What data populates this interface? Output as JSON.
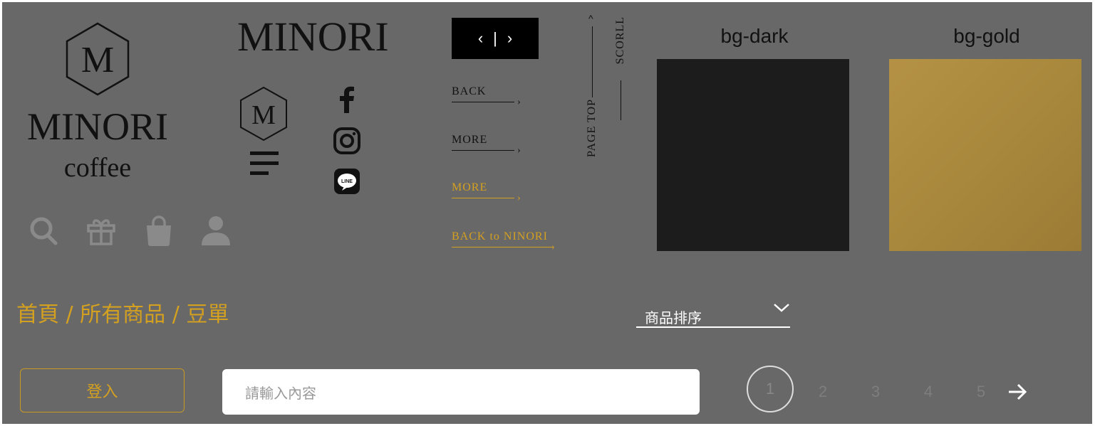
{
  "brand": {
    "hex_letter": "M",
    "name": "MINORI",
    "sub": "coffee",
    "wordmark": "MINORI"
  },
  "icons": {
    "menu": "menu-icon",
    "facebook": "facebook-icon",
    "instagram": "instagram-icon",
    "line": "line-icon",
    "line_text": "LINE",
    "search": "search-icon",
    "gift": "gift-icon",
    "bag": "shopping-bag-icon",
    "user": "user-icon"
  },
  "carousel": {
    "prev": "‹",
    "divider": "|",
    "next": "›"
  },
  "links": {
    "back": "BACK",
    "more_dark": "MORE",
    "more_gold": "MORE",
    "back_to": "BACK to NINORI"
  },
  "vertical": {
    "page_top": "PAGE TOP",
    "scroll": "SCORLL"
  },
  "swatches": {
    "dark_label": "bg-dark",
    "gold_label": "bg-gold"
  },
  "breadcrumb": {
    "text": "首頁 / 所有商品 / 豆單"
  },
  "sort": {
    "label": "商品排序"
  },
  "login": {
    "label": "登入"
  },
  "search": {
    "placeholder": "請輸入內容"
  },
  "pagination": {
    "pages": [
      "1",
      "2",
      "3",
      "4",
      "5"
    ],
    "current": "1"
  },
  "colors": {
    "background": "#686868",
    "gold": "#d4a020",
    "dark_swatch": "#1c1c1c",
    "gold_swatch": "#ad8c3f",
    "ink": "#111111"
  }
}
